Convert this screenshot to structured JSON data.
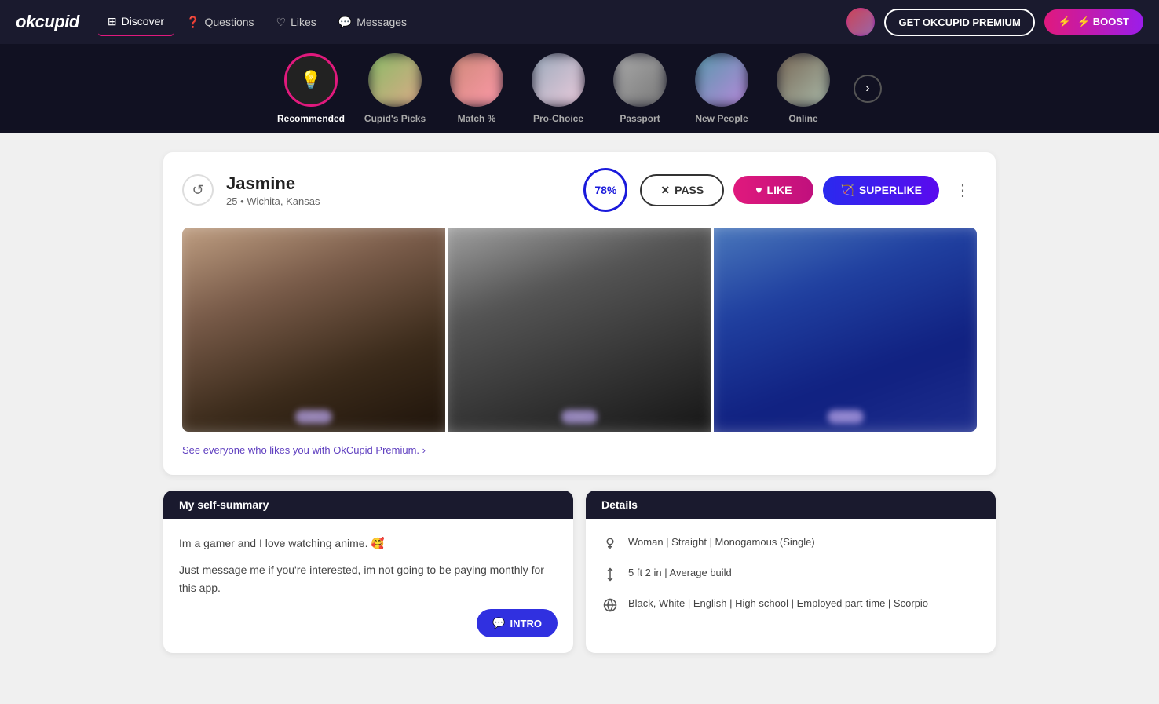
{
  "app": {
    "logo": "okcupid",
    "nav_items": [
      {
        "id": "discover",
        "label": "Discover",
        "icon": "⊞",
        "active": true
      },
      {
        "id": "questions",
        "label": "Questions",
        "icon": "?"
      },
      {
        "id": "likes",
        "label": "Likes",
        "icon": "♡"
      },
      {
        "id": "messages",
        "label": "Messages",
        "icon": "💬"
      }
    ],
    "premium_btn": "GET OKCUPID PREMIUM",
    "boost_btn": "⚡ BOOST"
  },
  "categories": [
    {
      "id": "recommended",
      "label": "Recommended",
      "type": "icon",
      "active": true
    },
    {
      "id": "cupids_picks",
      "label": "Cupid's Picks",
      "type": "thumb"
    },
    {
      "id": "match",
      "label": "Match %",
      "type": "thumb"
    },
    {
      "id": "pro_choice",
      "label": "Pro-Choice",
      "type": "thumb"
    },
    {
      "id": "passport",
      "label": "Passport",
      "type": "thumb"
    },
    {
      "id": "new_people",
      "label": "New People",
      "type": "thumb"
    },
    {
      "id": "online",
      "label": "Online",
      "type": "thumb"
    }
  ],
  "profile": {
    "name": "Jasmine",
    "age": "25",
    "location": "Wichita, Kansas",
    "match_pct": "78%",
    "pass_label": "PASS",
    "like_label": "LIKE",
    "superlike_label": "SUPERLIKE",
    "premium_promo": "See everyone who likes you with OkCupid Premium. ›",
    "photos": [
      {
        "bg": "photo-bg-1"
      },
      {
        "bg": "photo-bg-2"
      },
      {
        "bg": "photo-bg-3"
      }
    ],
    "self_summary_header": "My self-summary",
    "self_summary_line1": "Im a gamer and I love watching anime. 🥰",
    "self_summary_line2": "Just message me if you're interested, im not going to be paying monthly for this app.",
    "intro_btn": "INTRO",
    "details_header": "Details",
    "details": [
      {
        "icon": "👤",
        "text": "Woman | Straight | Monogamous (Single)"
      },
      {
        "icon": "📏",
        "text": "5 ft 2 in | Average build"
      },
      {
        "icon": "🌐",
        "text": "Black, White | English | High school | Employed part-time | Scorpio"
      }
    ]
  }
}
